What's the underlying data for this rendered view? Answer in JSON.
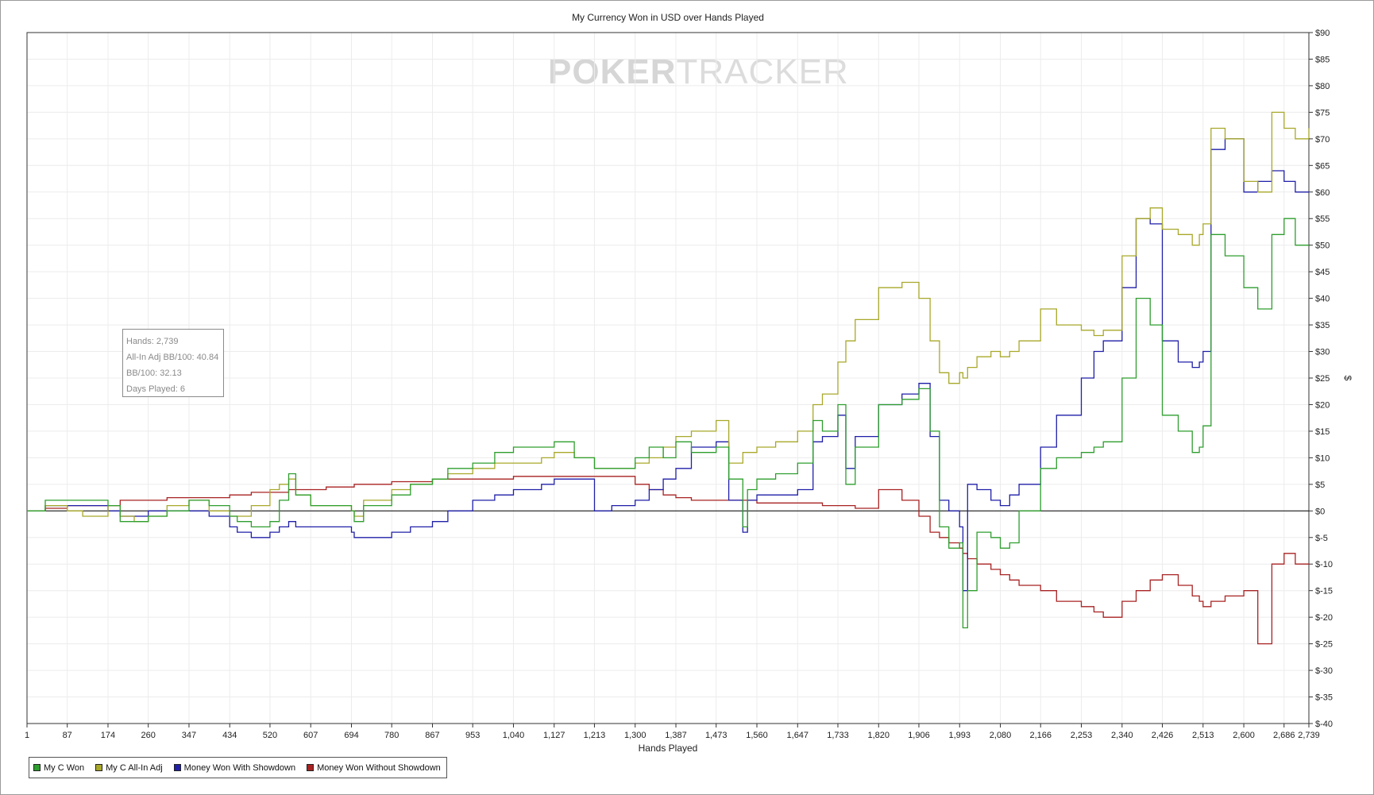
{
  "watermark": {
    "part1": "POKER",
    "part2": "TRACKER"
  },
  "stats": {
    "hands": "Hands: 2,739",
    "allin_bb": "All-In Adj BB/100: 40.84",
    "bb": "BB/100: 32.13",
    "days": "Days Played: 6"
  },
  "colors": {
    "won": "#2e9e2e",
    "allin": "#a8a82a",
    "showdown": "#1f1fa8",
    "nonshowdown": "#a82222",
    "grid": "#ececec",
    "zero_line": "#000000"
  },
  "chart_data": {
    "type": "line",
    "title": "My Currency Won in USD over Hands Played",
    "xlabel": "Hands Played",
    "ylabel": "$",
    "xlim": [
      1,
      2739
    ],
    "ylim": [
      -40,
      90
    ],
    "x_ticks": [
      "1",
      "87",
      "174",
      "260",
      "347",
      "434",
      "520",
      "607",
      "694",
      "780",
      "867",
      "953",
      "1,040",
      "1,127",
      "1,213",
      "1,300",
      "1,387",
      "1,473",
      "1,560",
      "1,647",
      "1,733",
      "1,820",
      "1,906",
      "1,993",
      "2,080",
      "2,166",
      "2,253",
      "2,340",
      "2,426",
      "2,513",
      "2,600",
      "2,686",
      "2,739"
    ],
    "y_ticks": [
      "$90",
      "$85",
      "$80",
      "$75",
      "$70",
      "$65",
      "$60",
      "$55",
      "$50",
      "$45",
      "$40",
      "$35",
      "$30",
      "$25",
      "$20",
      "$15",
      "$10",
      "$5",
      "$0",
      "$-5",
      "$-10",
      "$-15",
      "$-20",
      "$-25",
      "$-30",
      "$-35",
      "$-40"
    ],
    "grid": true,
    "legend_position": "bottom-left",
    "series": [
      {
        "name": "My C Won",
        "x": [
          1,
          40,
          87,
          120,
          174,
          200,
          230,
          260,
          300,
          347,
          390,
          434,
          450,
          480,
          520,
          540,
          560,
          575,
          607,
          640,
          694,
          700,
          720,
          780,
          820,
          867,
          900,
          953,
          1000,
          1040,
          1100,
          1127,
          1170,
          1213,
          1250,
          1300,
          1330,
          1360,
          1387,
          1420,
          1473,
          1500,
          1530,
          1540,
          1560,
          1600,
          1647,
          1680,
          1700,
          1733,
          1750,
          1770,
          1820,
          1870,
          1906,
          1930,
          1950,
          1970,
          1993,
          2000,
          2010,
          2030,
          2060,
          2080,
          2100,
          2120,
          2166,
          2200,
          2253,
          2280,
          2300,
          2340,
          2370,
          2400,
          2426,
          2460,
          2490,
          2505,
          2513,
          2530,
          2560,
          2600,
          2630,
          2660,
          2686,
          2710,
          2739
        ],
        "y": [
          0,
          2,
          2,
          2,
          1,
          -2,
          -2,
          -1,
          0,
          2,
          1,
          -1,
          -2,
          -3,
          -2,
          2,
          7,
          3,
          1,
          1,
          0,
          -2,
          1,
          3,
          5,
          6,
          8,
          9,
          11,
          12,
          12,
          13,
          10,
          8,
          8,
          10,
          12,
          10,
          13,
          11,
          12,
          6,
          -3,
          4,
          6,
          7,
          9,
          17,
          15,
          20,
          5,
          12,
          20,
          21,
          23,
          15,
          -3,
          -7,
          -6,
          -22,
          -15,
          -4,
          -5,
          -7,
          -6,
          0,
          8,
          10,
          11,
          12,
          13,
          25,
          40,
          35,
          18,
          15,
          11,
          12,
          16,
          52,
          48,
          42,
          38,
          52,
          55,
          50,
          50
        ]
      },
      {
        "name": "My C All-In Adj",
        "x": [
          1,
          40,
          87,
          120,
          174,
          200,
          230,
          260,
          300,
          347,
          390,
          434,
          450,
          480,
          520,
          540,
          560,
          575,
          607,
          640,
          694,
          700,
          720,
          780,
          820,
          867,
          900,
          953,
          1000,
          1040,
          1100,
          1127,
          1170,
          1213,
          1250,
          1300,
          1330,
          1360,
          1387,
          1420,
          1473,
          1500,
          1530,
          1540,
          1560,
          1600,
          1647,
          1680,
          1700,
          1733,
          1750,
          1770,
          1820,
          1870,
          1906,
          1930,
          1950,
          1970,
          1993,
          2000,
          2010,
          2030,
          2060,
          2080,
          2100,
          2120,
          2166,
          2200,
          2253,
          2280,
          2300,
          2340,
          2370,
          2400,
          2426,
          2460,
          2490,
          2505,
          2513,
          2530,
          2560,
          2600,
          2630,
          2660,
          2686,
          2710,
          2739
        ],
        "y": [
          0,
          1,
          0,
          -1,
          1,
          -1,
          -2,
          -1,
          1,
          2,
          0,
          -1,
          -1,
          1,
          4,
          5,
          6,
          3,
          1,
          1,
          0,
          -1,
          2,
          4,
          5,
          6,
          7,
          8,
          9,
          9,
          10,
          11,
          10,
          8,
          8,
          9,
          10,
          12,
          14,
          15,
          17,
          9,
          11,
          11,
          12,
          13,
          15,
          20,
          22,
          28,
          32,
          36,
          42,
          43,
          40,
          32,
          26,
          24,
          26,
          25,
          27,
          29,
          30,
          29,
          30,
          32,
          38,
          35,
          34,
          33,
          34,
          48,
          55,
          57,
          53,
          52,
          50,
          52,
          54,
          72,
          70,
          62,
          60,
          75,
          72,
          70,
          72
        ]
      },
      {
        "name": "Money Won With Showdown",
        "x": [
          1,
          40,
          87,
          120,
          174,
          200,
          230,
          260,
          300,
          347,
          390,
          434,
          450,
          480,
          520,
          540,
          560,
          575,
          607,
          640,
          694,
          700,
          720,
          780,
          820,
          867,
          900,
          953,
          1000,
          1040,
          1100,
          1127,
          1170,
          1213,
          1250,
          1300,
          1330,
          1360,
          1387,
          1420,
          1473,
          1500,
          1530,
          1540,
          1560,
          1600,
          1647,
          1680,
          1700,
          1733,
          1750,
          1770,
          1820,
          1870,
          1906,
          1930,
          1950,
          1970,
          1993,
          2000,
          2010,
          2030,
          2060,
          2080,
          2100,
          2120,
          2166,
          2200,
          2253,
          2280,
          2300,
          2340,
          2370,
          2400,
          2426,
          2460,
          2490,
          2505,
          2513,
          2530,
          2560,
          2600,
          2630,
          2660,
          2686,
          2710,
          2739
        ],
        "y": [
          0,
          1,
          1,
          1,
          0,
          -1,
          -1,
          0,
          0,
          0,
          -1,
          -3,
          -4,
          -5,
          -4,
          -3,
          -2,
          -3,
          -3,
          -3,
          -4,
          -5,
          -5,
          -4,
          -3,
          -2,
          0,
          2,
          3,
          4,
          5,
          6,
          6,
          0,
          1,
          2,
          4,
          6,
          8,
          12,
          13,
          2,
          -4,
          2,
          3,
          3,
          4,
          13,
          14,
          18,
          8,
          14,
          20,
          22,
          24,
          14,
          2,
          0,
          -3,
          -15,
          5,
          4,
          2,
          1,
          3,
          5,
          12,
          18,
          25,
          30,
          32,
          42,
          55,
          54,
          32,
          28,
          27,
          28,
          30,
          68,
          70,
          60,
          62,
          64,
          62,
          60,
          60
        ]
      },
      {
        "name": "Money Won Without Showdown",
        "x": [
          1,
          40,
          87,
          120,
          174,
          200,
          230,
          260,
          300,
          347,
          390,
          434,
          450,
          480,
          520,
          540,
          560,
          575,
          607,
          640,
          694,
          700,
          720,
          780,
          820,
          867,
          900,
          953,
          1000,
          1040,
          1100,
          1127,
          1170,
          1213,
          1250,
          1300,
          1330,
          1360,
          1387,
          1420,
          1473,
          1500,
          1530,
          1540,
          1560,
          1600,
          1647,
          1680,
          1700,
          1733,
          1750,
          1770,
          1820,
          1870,
          1906,
          1930,
          1950,
          1970,
          1993,
          2000,
          2010,
          2030,
          2060,
          2080,
          2100,
          2120,
          2166,
          2200,
          2253,
          2280,
          2300,
          2340,
          2370,
          2400,
          2426,
          2460,
          2490,
          2505,
          2513,
          2530,
          2560,
          2600,
          2630,
          2660,
          2686,
          2710,
          2739
        ],
        "y": [
          0,
          0.5,
          1,
          1,
          1,
          2,
          2,
          2,
          2.5,
          2.5,
          2.5,
          3,
          3,
          3.5,
          3.5,
          3.5,
          4,
          4,
          4,
          4.5,
          4.5,
          5,
          5,
          5.5,
          5.5,
          6,
          6,
          6,
          6,
          6.5,
          6.5,
          6.5,
          6.5,
          6.5,
          6.5,
          5,
          4,
          3,
          2.5,
          2,
          2,
          2,
          2,
          2,
          1.5,
          1.5,
          1.5,
          1.5,
          1,
          1,
          1,
          0.5,
          4,
          2,
          -1,
          -4,
          -5,
          -6,
          -7,
          -8,
          -9,
          -10,
          -11,
          -12,
          -13,
          -14,
          -15,
          -17,
          -18,
          -19,
          -20,
          -17,
          -15,
          -13,
          -12,
          -14,
          -16,
          -17,
          -18,
          -17,
          -16,
          -15,
          -25,
          -10,
          -8,
          -10,
          -10
        ]
      }
    ]
  },
  "legend": {
    "items": [
      "My C Won",
      "My C All-In Adj",
      "Money Won With Showdown",
      "Money Won Without Showdown"
    ]
  }
}
